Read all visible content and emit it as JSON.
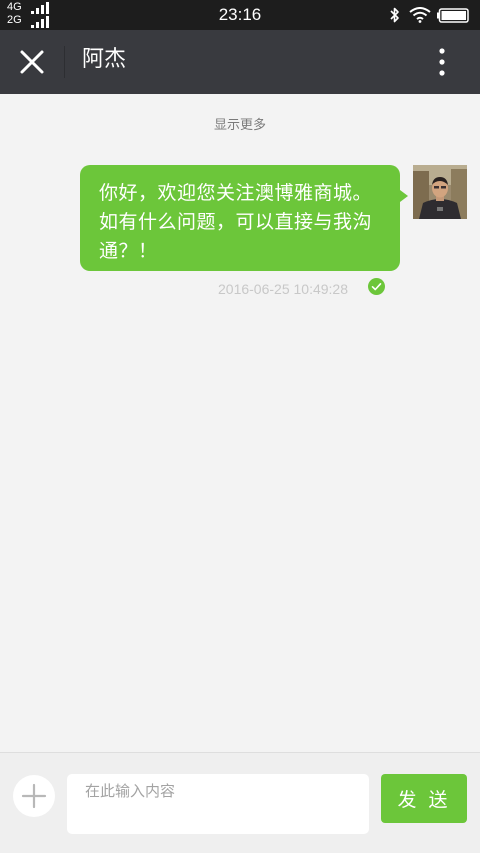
{
  "status_bar": {
    "network_top": "4G",
    "network_bottom": "2G",
    "time": "23:16",
    "icons": [
      "bluetooth-icon",
      "wifi-icon",
      "battery-icon"
    ]
  },
  "header": {
    "title": "阿杰",
    "close_icon": "close-icon",
    "more_icon": "more-vertical-icon"
  },
  "chat": {
    "show_more": "显示更多",
    "messages": [
      {
        "line1": "你好，欢迎您关注澳博雅商城。",
        "line2": "如有什么问题，可以直接与我沟",
        "line3": "通？！",
        "timestamp": "2016-06-25 10:49:28",
        "status_icon": "sent-check-icon"
      }
    ]
  },
  "composer": {
    "placeholder": "在此输入内容",
    "value": "",
    "send_label": "发 送",
    "plus_icon": "plus-icon"
  },
  "colors": {
    "status_bar": "#1d1d1d",
    "title_bar": "#393a3f",
    "accent_green": "#6cc63a",
    "background": "#f3f3f3"
  }
}
